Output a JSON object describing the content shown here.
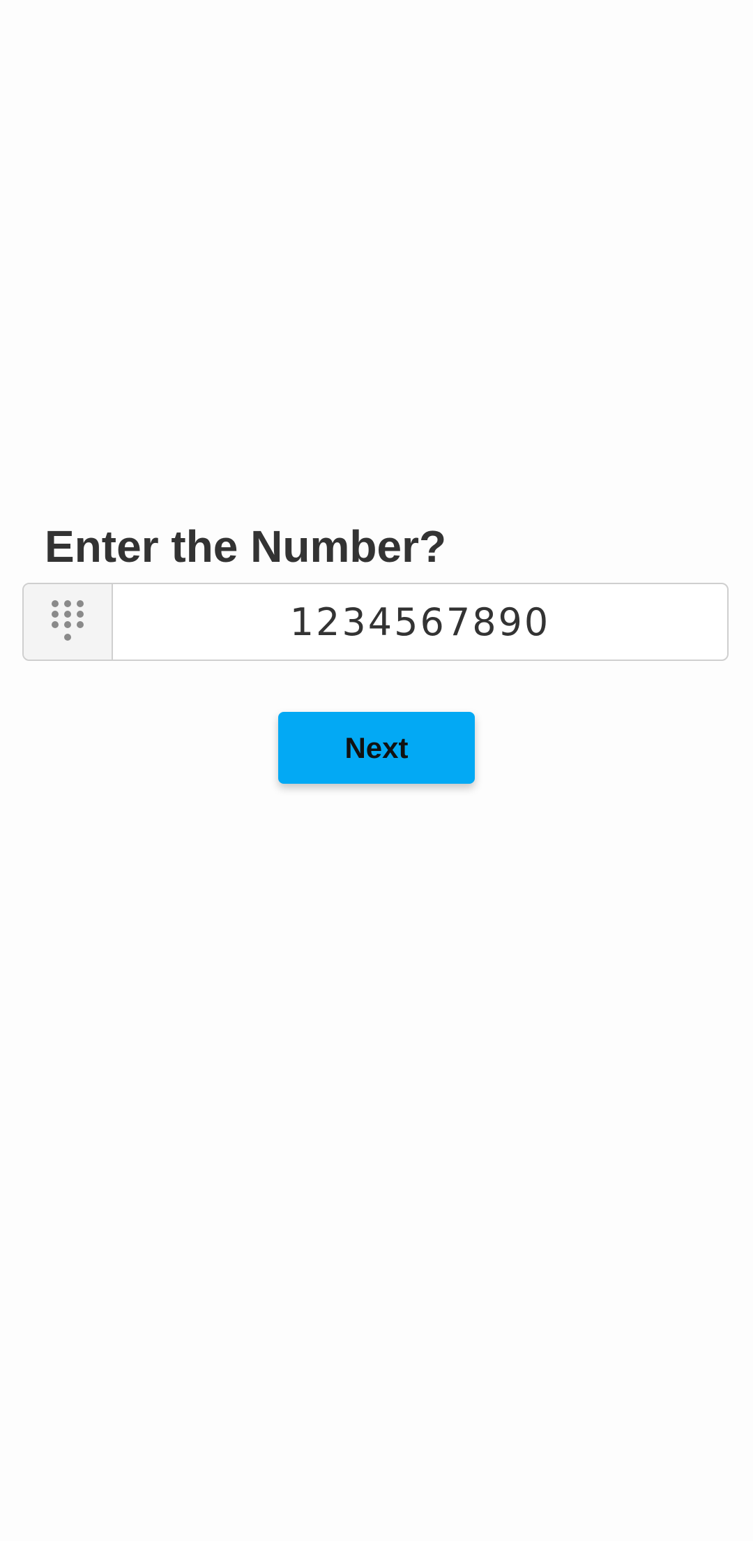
{
  "form": {
    "heading": "Enter the Number?",
    "number_value": "1234567890",
    "addon_icon": "dialpad-icon",
    "next_label": "Next"
  },
  "colors": {
    "accent": "#03a9f4",
    "heading_text": "#333333",
    "icon": "#8a8a8a",
    "border": "#cfcfcf"
  }
}
